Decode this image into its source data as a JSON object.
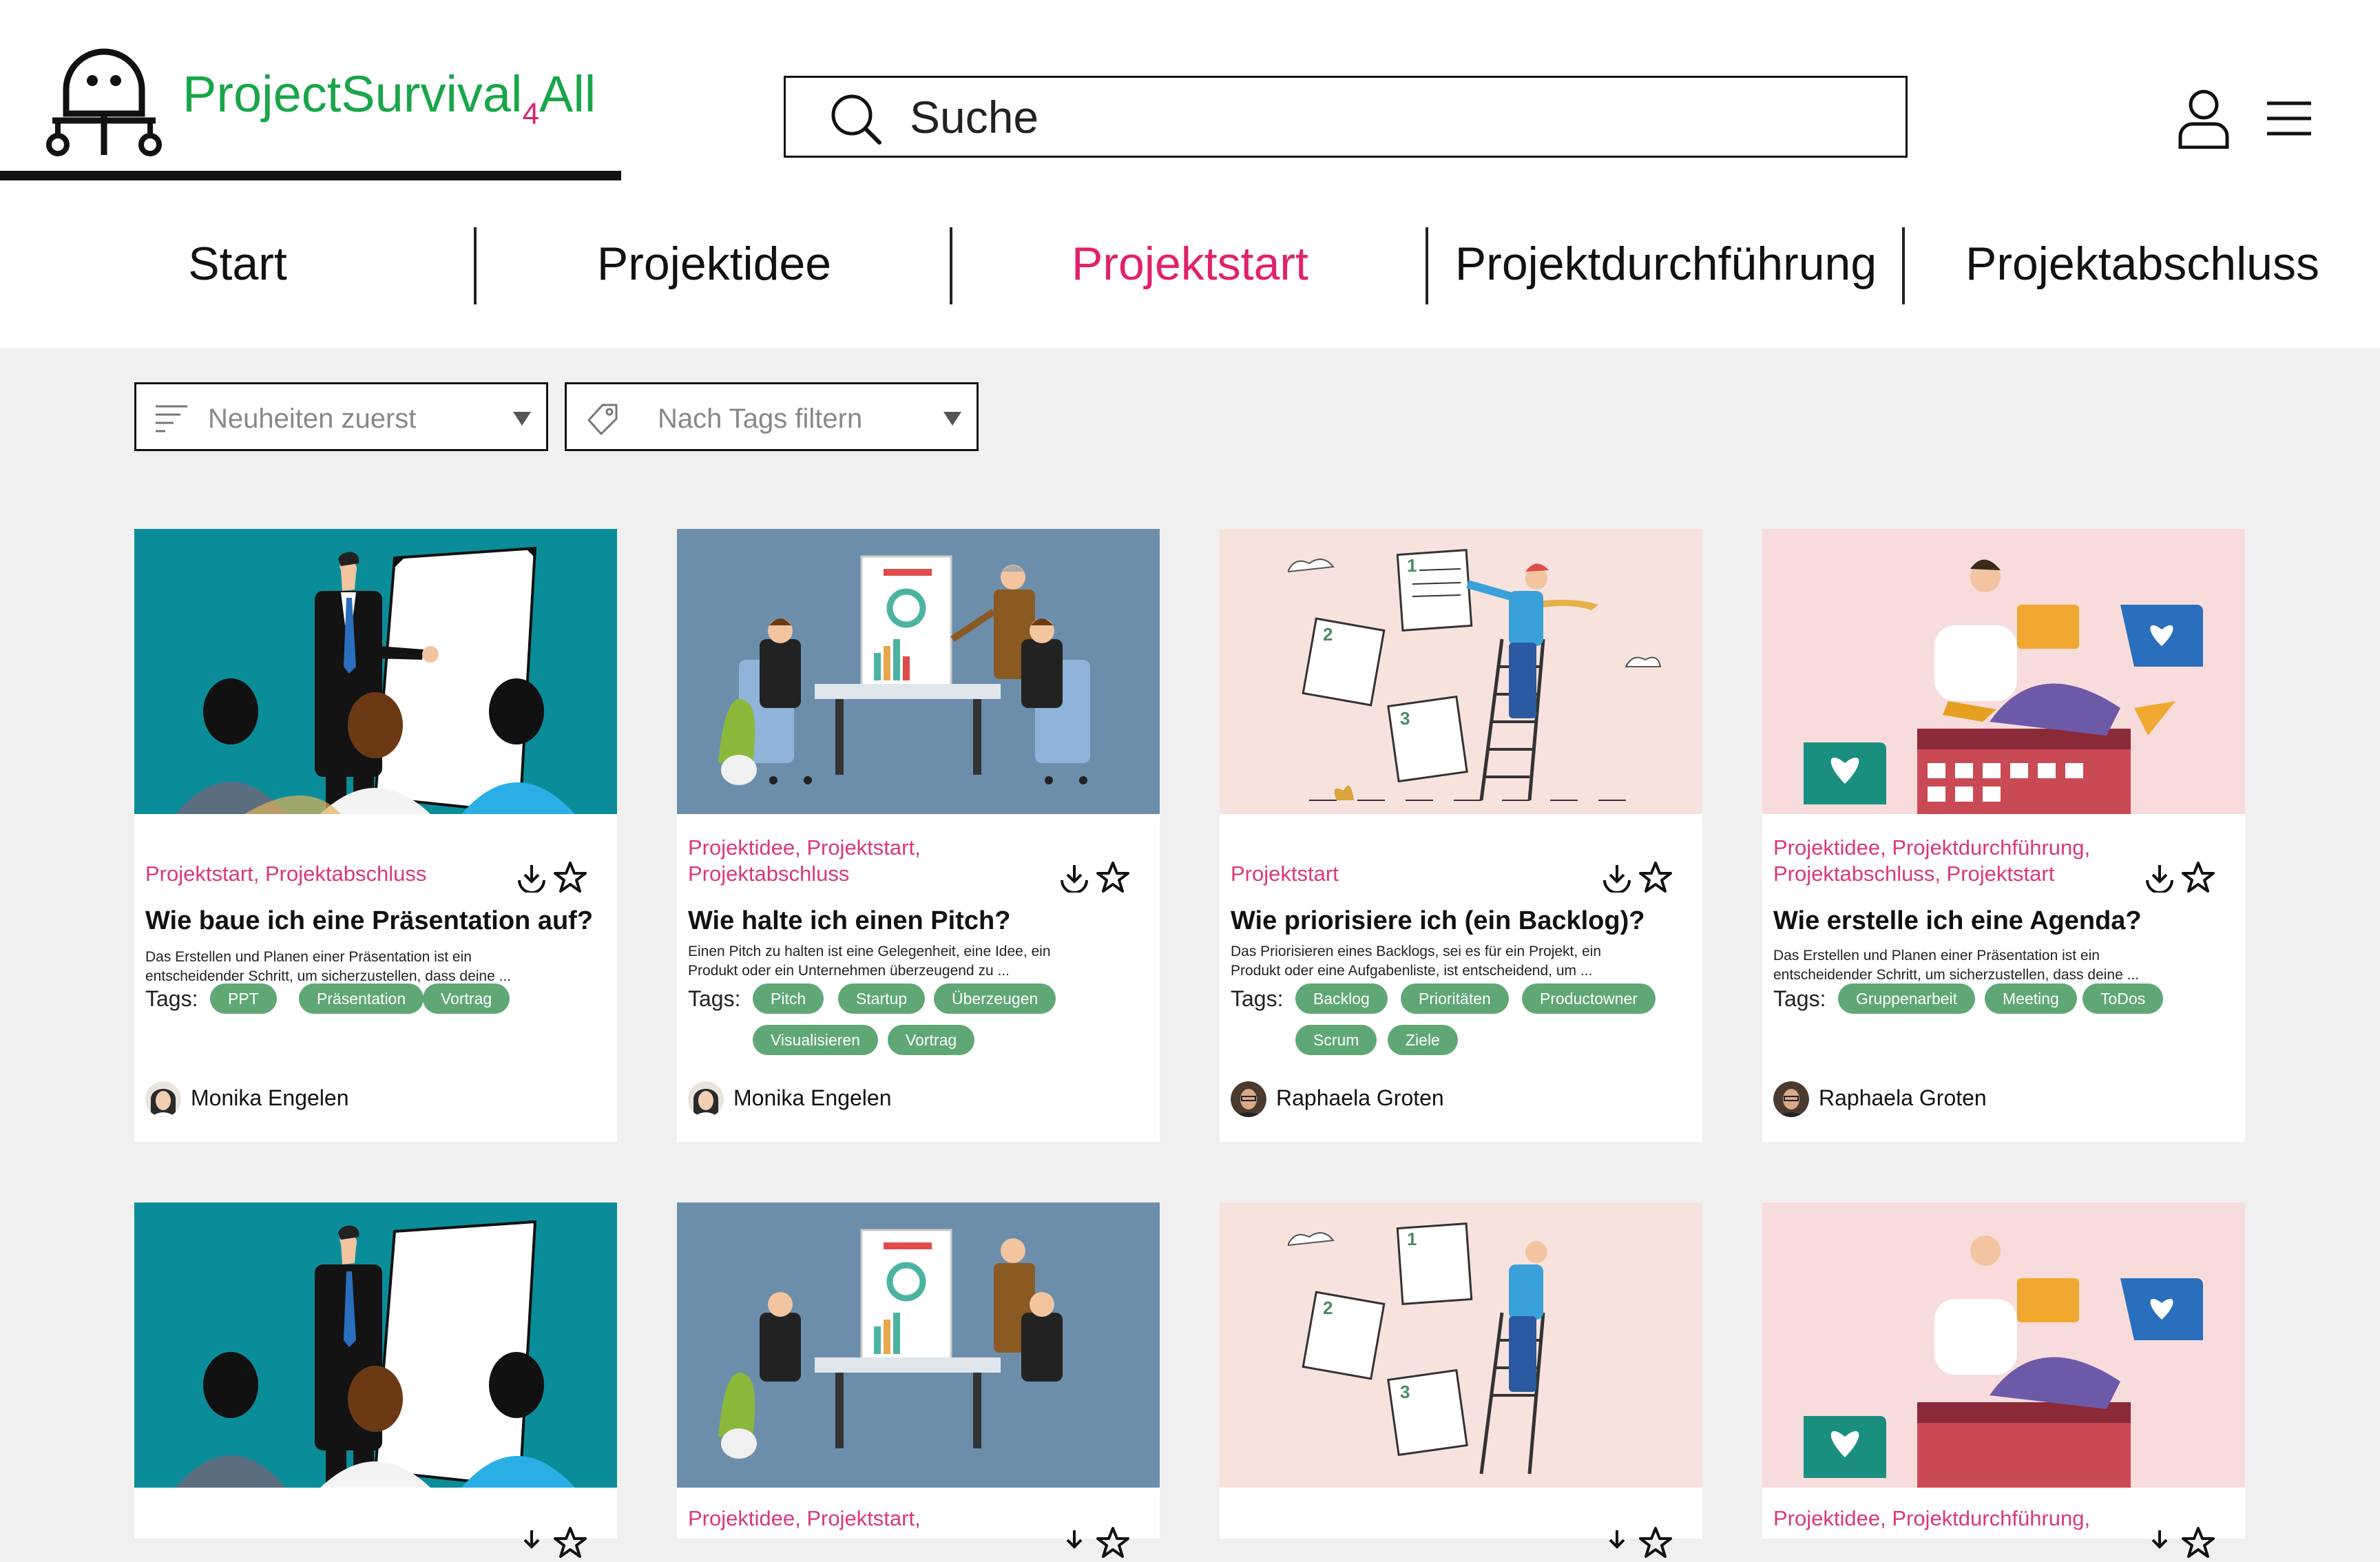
{
  "brand": {
    "name": "ProjectSurvival",
    "suffix_small": "4",
    "suffix": "All"
  },
  "search": {
    "placeholder": "Suche"
  },
  "nav": [
    {
      "label": "Start",
      "active": false
    },
    {
      "label": "Projektidee",
      "active": false
    },
    {
      "label": "Projektstart",
      "active": true
    },
    {
      "label": "Projektdurchführung",
      "active": false
    },
    {
      "label": "Projektabschluss",
      "active": false
    }
  ],
  "filters": {
    "sort": {
      "label": "Neuheiten zuerst",
      "icon": "sort-icon"
    },
    "tags": {
      "label": "Nach Tags filtern",
      "icon": "tag-icon"
    }
  },
  "tags_label": "Tags:",
  "cards": [
    {
      "categories": [
        "Projektstart, Projektabschluss"
      ],
      "title": "Wie baue ich eine Präsentation auf?",
      "description": [
        "Das Erstellen und Planen einer Präsentation ist ein",
        "entscheidender  Schritt, um sicherzustellen, dass deine ..."
      ],
      "tags": [
        "PPT",
        "Präsentation",
        "Vortrag"
      ],
      "author": "Monika Engelen",
      "image": "presentation-illustration"
    },
    {
      "categories": [
        "Projektidee, Projektstart,",
        "Projektabschluss"
      ],
      "title": "Wie halte ich einen Pitch?",
      "description": [
        "Einen Pitch zu halten ist eine Gelegenheit, eine Idee, ein",
        "Produkt oder ein Unternehmen überzeugend zu ..."
      ],
      "tags": [
        "Pitch",
        "Startup",
        "Überzeugen",
        "Visualisieren",
        "Vortrag"
      ],
      "author": "Monika Engelen",
      "image": "pitch-meeting-illustration"
    },
    {
      "categories": [
        "Projektstart"
      ],
      "title": "Wie priorisiere ich (ein Backlog)?",
      "description": [
        "Das Priorisieren eines Backlogs, sei es für ein Projekt, ein",
        "Produkt oder eine Aufgabenliste, ist entscheidend, um ..."
      ],
      "tags": [
        "Backlog",
        "Prioritäten",
        "Productowner",
        "Scrum",
        "Ziele"
      ],
      "author": "Raphaela Groten",
      "image": "backlog-ladder-illustration"
    },
    {
      "categories": [
        "Projektidee, Projektdurchführung,",
        "Projektabschluss, Projektstart"
      ],
      "title": "Wie erstelle ich eine Agenda?",
      "description": [
        "Das Erstellen und Planen einer Präsentation ist ein",
        "entscheidender  Schritt, um sicherzustellen, dass deine ..."
      ],
      "tags": [
        "Gruppenarbeit",
        "Meeting",
        "ToDos"
      ],
      "author": "Raphaela Groten",
      "image": "agenda-calendar-illustration"
    }
  ],
  "cards_row2": [
    {
      "categories": [
        ""
      ],
      "image": "presentation-illustration"
    },
    {
      "categories": [
        "Projektidee, Projektstart,"
      ],
      "image": "pitch-meeting-illustration"
    },
    {
      "categories": [
        ""
      ],
      "image": "backlog-ladder-illustration"
    },
    {
      "categories": [
        "Projektidee, Projektdurchführung,"
      ],
      "image": "agenda-calendar-illustration"
    }
  ],
  "colors": {
    "accent": "#e0226c",
    "brand_green": "#19a64a",
    "tag_green": "#5fa876",
    "category_pink": "#d9387e"
  }
}
